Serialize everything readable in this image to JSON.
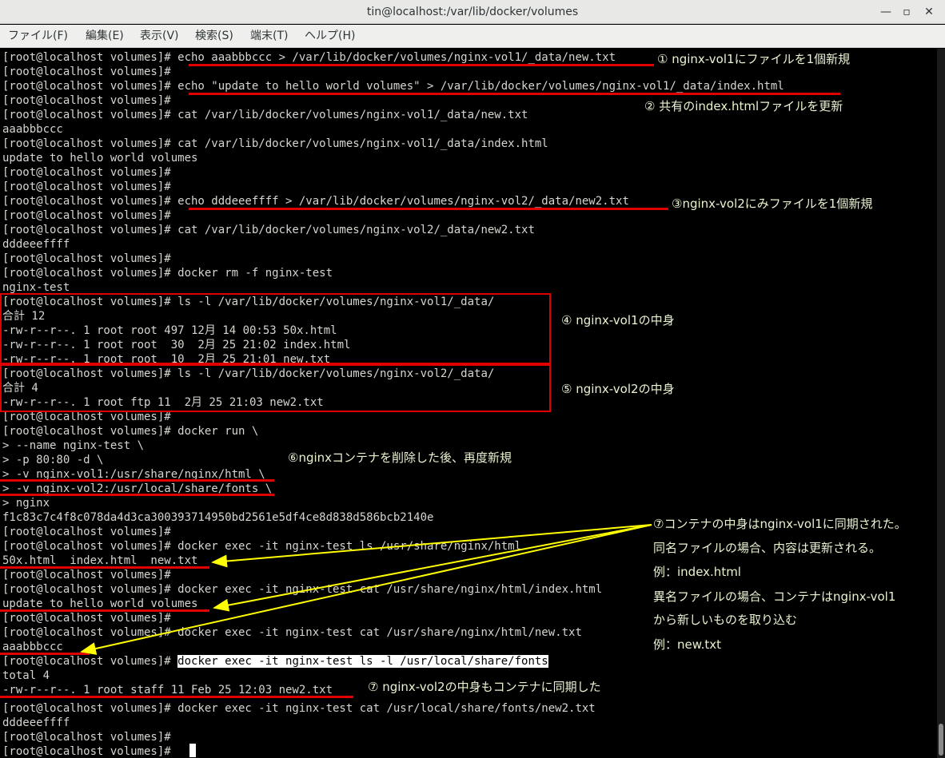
{
  "window": {
    "title": "tin@localhost:/var/lib/docker/volumes",
    "minimize_glyph": "—",
    "maximize_glyph": "▫",
    "close_glyph": "✕"
  },
  "menu": [
    "ファイル(F)",
    "編集(E)",
    "表示(V)",
    "検索(S)",
    "端末(T)",
    "ヘルプ(H)"
  ],
  "terminal": {
    "lines": [
      "[root@localhost volumes]# echo aaabbbccc > /var/lib/docker/volumes/nginx-vol1/_data/new.txt",
      "[root@localhost volumes]#",
      "[root@localhost volumes]# echo \"update to hello world volumes\" > /var/lib/docker/volumes/nginx-vol1/_data/index.html",
      "[root@localhost volumes]#",
      "[root@localhost volumes]# cat /var/lib/docker/volumes/nginx-vol1/_data/new.txt",
      "aaabbbccc",
      "[root@localhost volumes]# cat /var/lib/docker/volumes/nginx-vol1/_data/index.html",
      "update to hello world volumes",
      "[root@localhost volumes]#",
      "[root@localhost volumes]#",
      "[root@localhost volumes]# echo dddeeeffff > /var/lib/docker/volumes/nginx-vol2/_data/new2.txt",
      "[root@localhost volumes]#",
      "[root@localhost volumes]# cat /var/lib/docker/volumes/nginx-vol2/_data/new2.txt",
      "dddeeeffff",
      "[root@localhost volumes]#",
      "[root@localhost volumes]# docker rm -f nginx-test",
      "nginx-test",
      "[root@localhost volumes]# ls -l /var/lib/docker/volumes/nginx-vol1/_data/",
      "合計 12",
      "-rw-r--r--. 1 root root 497 12月 14 00:53 50x.html",
      "-rw-r--r--. 1 root root  30  2月 25 21:02 index.html",
      "-rw-r--r--. 1 root root  10  2月 25 21:01 new.txt",
      "[root@localhost volumes]# ls -l /var/lib/docker/volumes/nginx-vol2/_data/",
      "合計 4",
      "-rw-r--r--. 1 root ftp 11  2月 25 21:03 new2.txt",
      "[root@localhost volumes]#",
      "[root@localhost volumes]# docker run \\",
      "> --name nginx-test \\",
      "> -p 80:80 -d \\",
      "> -v nginx-vol1:/usr/share/nginx/html \\",
      "> -v nginx-vol2:/usr/local/share/fonts \\",
      "> nginx",
      "f1c83c7c4f8c078da4d3ca300393714950bd2561e5df4ce8d838d586bcb2140e",
      "[root@localhost volumes]#",
      "[root@localhost volumes]# docker exec -it nginx-test ls /usr/share/nginx/html",
      "50x.html  index.html  new.txt",
      "[root@localhost volumes]#",
      "[root@localhost volumes]# docker exec -it nginx-test cat /usr/share/nginx/html/index.html",
      "update to hello world volumes",
      "[root@localhost volumes]#",
      "[root@localhost volumes]# docker exec -it nginx-test cat /usr/share/nginx/html/new.txt",
      "aaabbbccc",
      "[root@localhost volumes]# ",
      "total 4",
      "-rw-r--r--. 1 root staff 11 Feb 25 12:03 new2.txt",
      "[root@localhost volumes]# docker exec -it nginx-test cat /usr/local/share/fonts/new2.txt",
      "dddeeeffff",
      "[root@localhost volumes]#",
      "[root@localhost volumes]# "
    ],
    "selected_command": "docker exec -it nginx-test ls -l /usr/local/share/fonts"
  },
  "annotations": {
    "a1": "① nginx-vol1にファイルを1個新規",
    "a2": "② 共有のindex.htmlファイルを更新",
    "a3": "③nginx-vol2にみファイルを1個新規",
    "a4": "④ nginx-vol1の中身",
    "a5": "⑤ nginx-vol2の中身",
    "a6": "⑥nginxコンテナを削除した後、再度新規",
    "a7_lines": [
      "⑦コンテナの中身はnginx-vol1に同期された。",
      "同名ファイルの場合、内容は更新される。",
      "例：index.html",
      "異名ファイルの場合、コンテナはnginx-vol1",
      "から新しいものを取り込む",
      "例：new.txt"
    ],
    "a8": "⑦ nginx-vol2の中身もコンテナに同期した"
  },
  "colors": {
    "annotation_red": "#e00000",
    "arrow_yellow": "#ffff00",
    "annotation_text": "#e8f3d0",
    "terminal_text": "#d3d7cf"
  }
}
